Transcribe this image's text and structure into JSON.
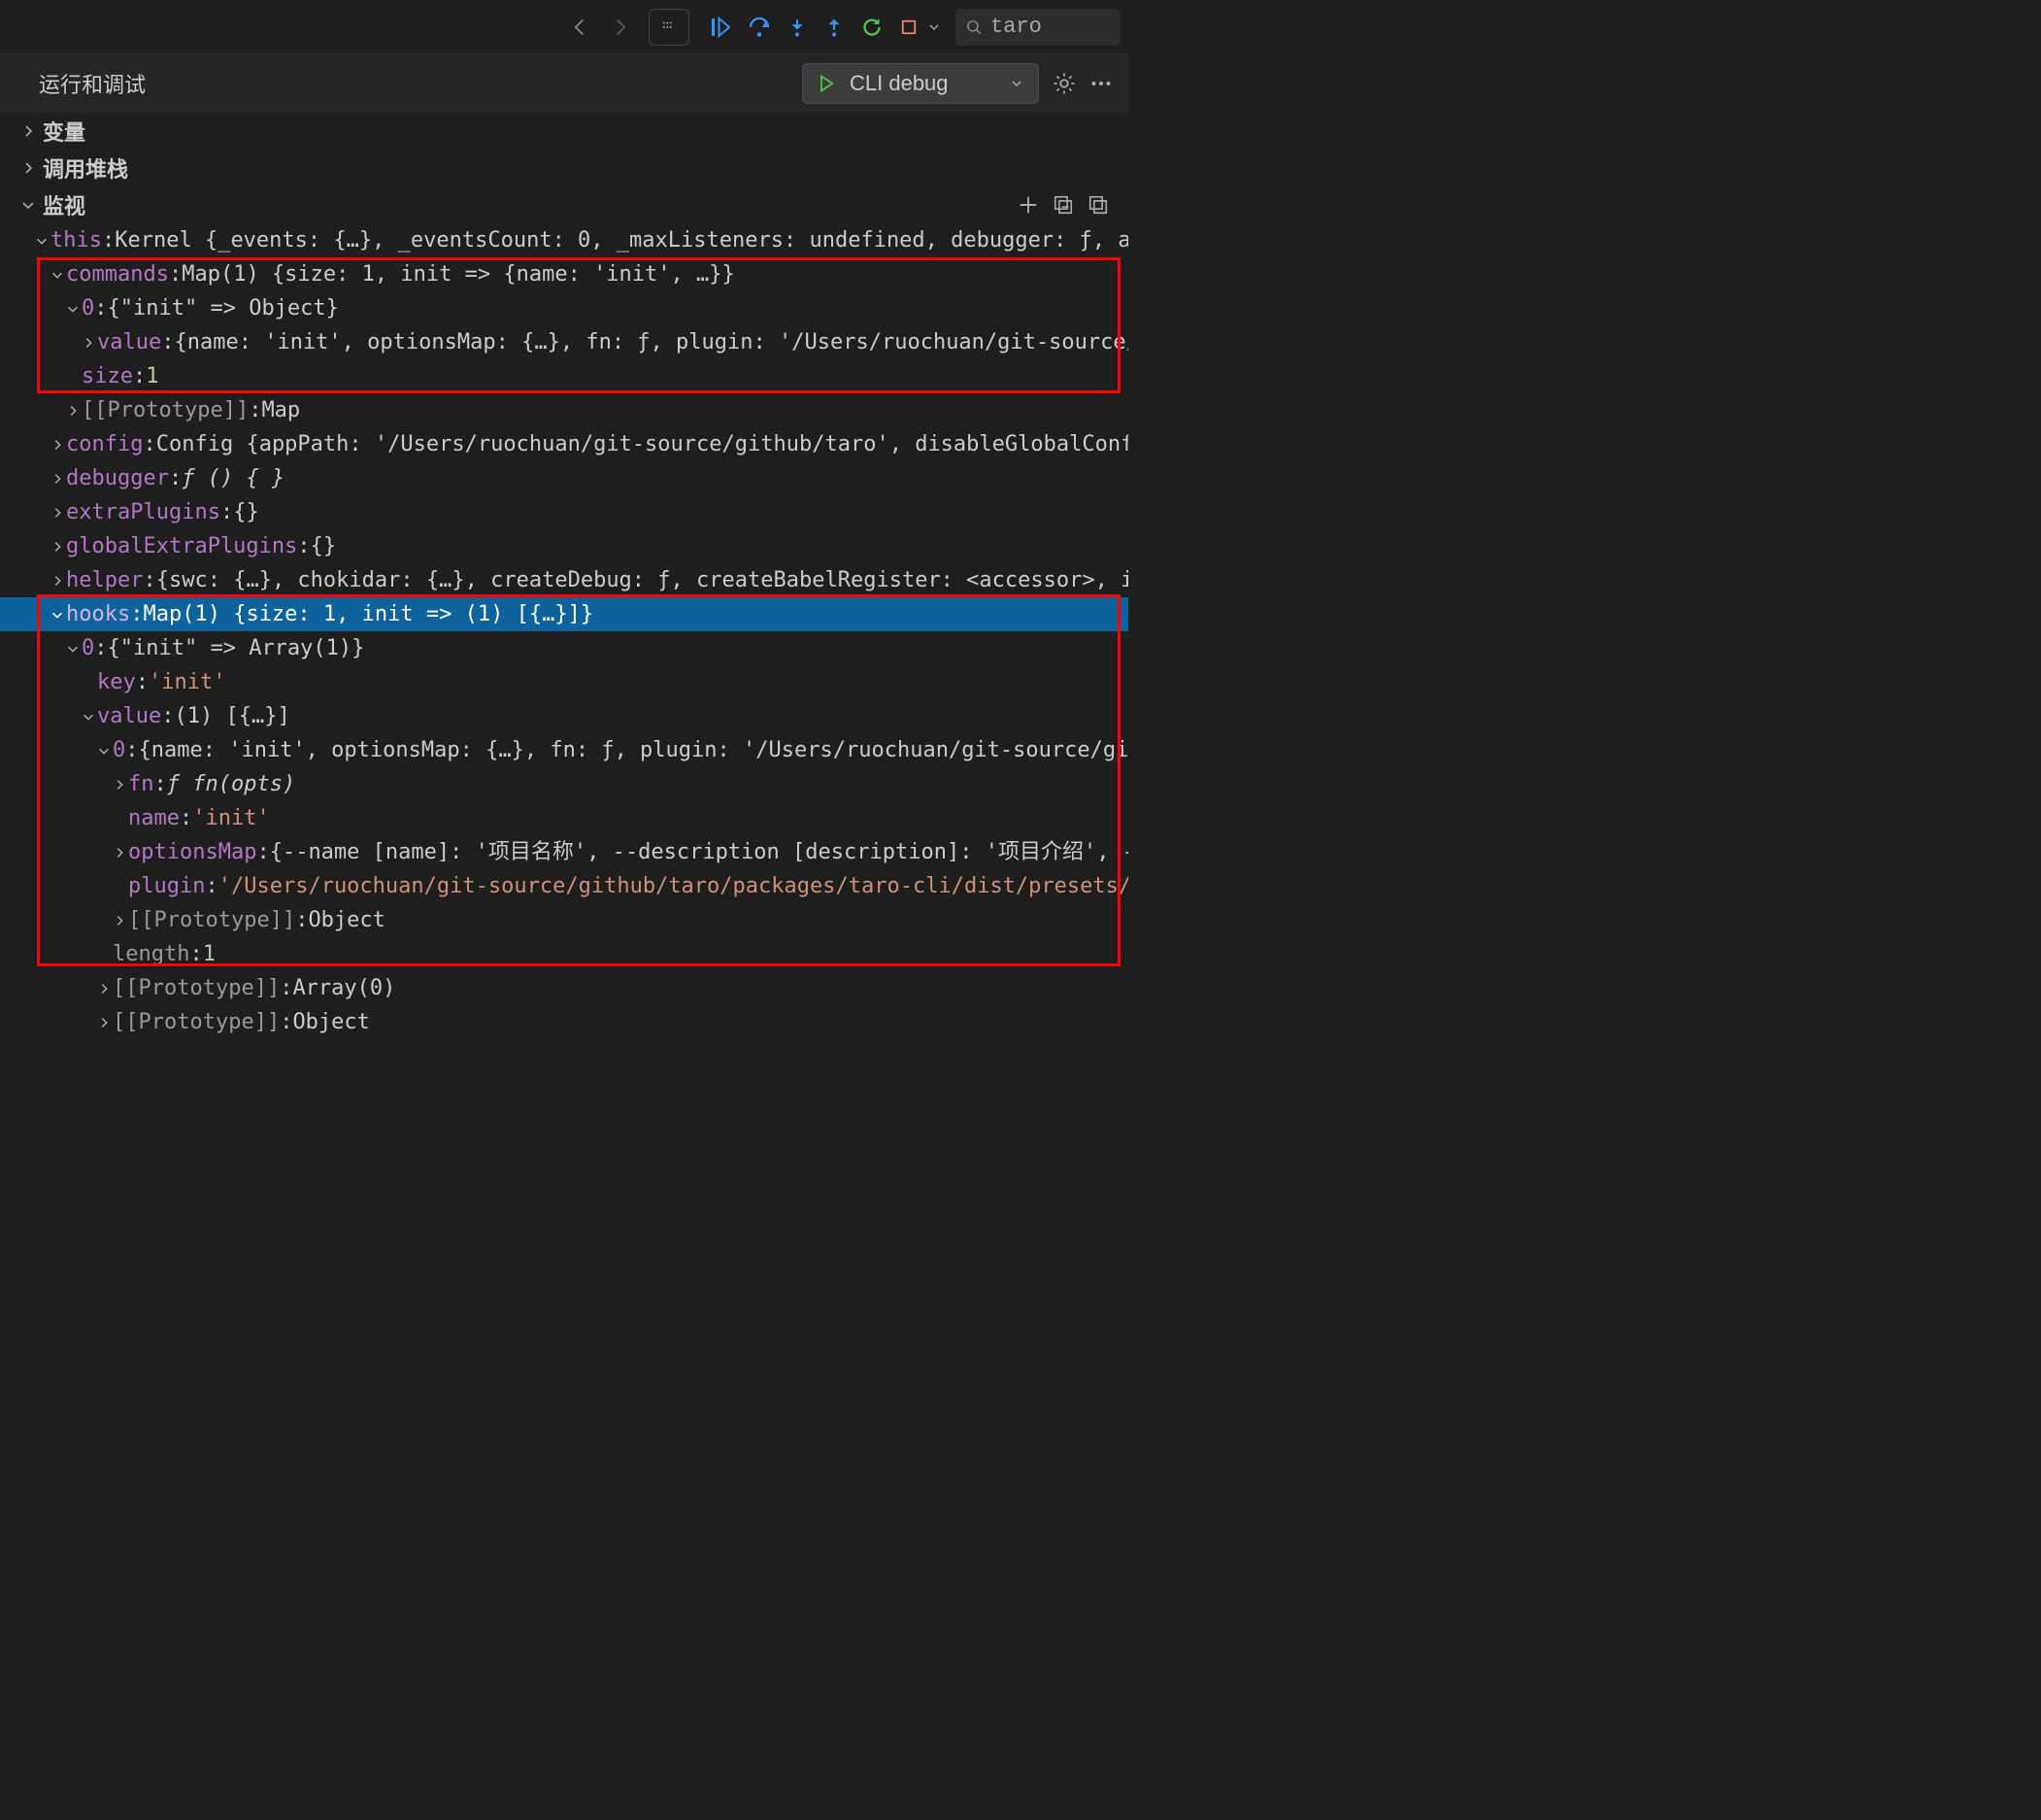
{
  "toolbar": {
    "search_text": "taro"
  },
  "panel": {
    "title": "运行和调试",
    "config_label": "CLI debug"
  },
  "sections": {
    "variables": "变量",
    "callstack": "调用堆栈",
    "watch": "监视"
  },
  "tree": {
    "this": {
      "key": "this",
      "preview": "Kernel {_events: {…}, _eventsCount: 0, _maxListeners: undefined, debugger: ƒ, appPath: '/Users/ruo…"
    },
    "commands": {
      "key": "commands",
      "preview": "Map(1) {size: 1, init => {name: 'init', …}}",
      "entry0": {
        "key": "0",
        "preview": "{\"init\" => Object}",
        "value": {
          "key": "value",
          "preview": "{name: 'init', optionsMap: {…}, fn: ƒ, plugin: '/Users/ruochuan/git-source/github/taro/packag…"
        }
      },
      "size": {
        "key": "size",
        "value": "1"
      },
      "proto": {
        "key": "[[Prototype]]",
        "value": "Map"
      }
    },
    "config": {
      "key": "config",
      "preview": "Config {appPath: '/Users/ruochuan/git-source/github/taro', disableGlobalConfig: false, initialC…"
    },
    "debugger": {
      "key": "debugger",
      "preview": "ƒ () { }"
    },
    "extraPlugins": {
      "key": "extraPlugins",
      "preview": "{}"
    },
    "globalExtraPlugins": {
      "key": "globalExtraPlugins",
      "preview": "{}"
    },
    "helper": {
      "key": "helper",
      "preview": "{swc: {…}, chokidar: {…}, createDebug: ƒ, createBabelRegister: <accessor>, injectDefineConfigHe…"
    },
    "hooks": {
      "key": "hooks",
      "preview": "Map(1) {size: 1, init => (1) [{…}]}",
      "entry0": {
        "key": "0",
        "preview": "{\"init\" => Array(1)}",
        "keyprop": {
          "key": "key",
          "value": "'init'"
        },
        "value": {
          "key": "value",
          "preview": "(1) [{…}]",
          "idx0": {
            "key": "0",
            "preview": "{name: 'init', optionsMap: {…}, fn: ƒ, plugin: '/Users/ruochuan/git-source/github/taro/packages/…",
            "fn": {
              "key": "fn",
              "preview": "ƒ fn(opts)"
            },
            "name": {
              "key": "name",
              "value": "'init'"
            },
            "optionsMap": {
              "key": "optionsMap",
              "preview": "{--name [name]: '项目名称', --description [description]: '项目介绍', --typescript: '使用T…"
            },
            "plugin": {
              "key": "plugin",
              "value": "'/Users/ruochuan/git-source/github/taro/packages/taro-cli/dist/presets/commands/init.js'"
            },
            "proto": {
              "key": "[[Prototype]]",
              "value": "Object"
            }
          },
          "length": {
            "key": "length",
            "value": "1"
          },
          "proto": {
            "key": "[[Prototype]]",
            "value": "Array(0)"
          },
          "proto2": {
            "key": "[[Prototype]]",
            "value": "Object"
          }
        }
      }
    }
  }
}
